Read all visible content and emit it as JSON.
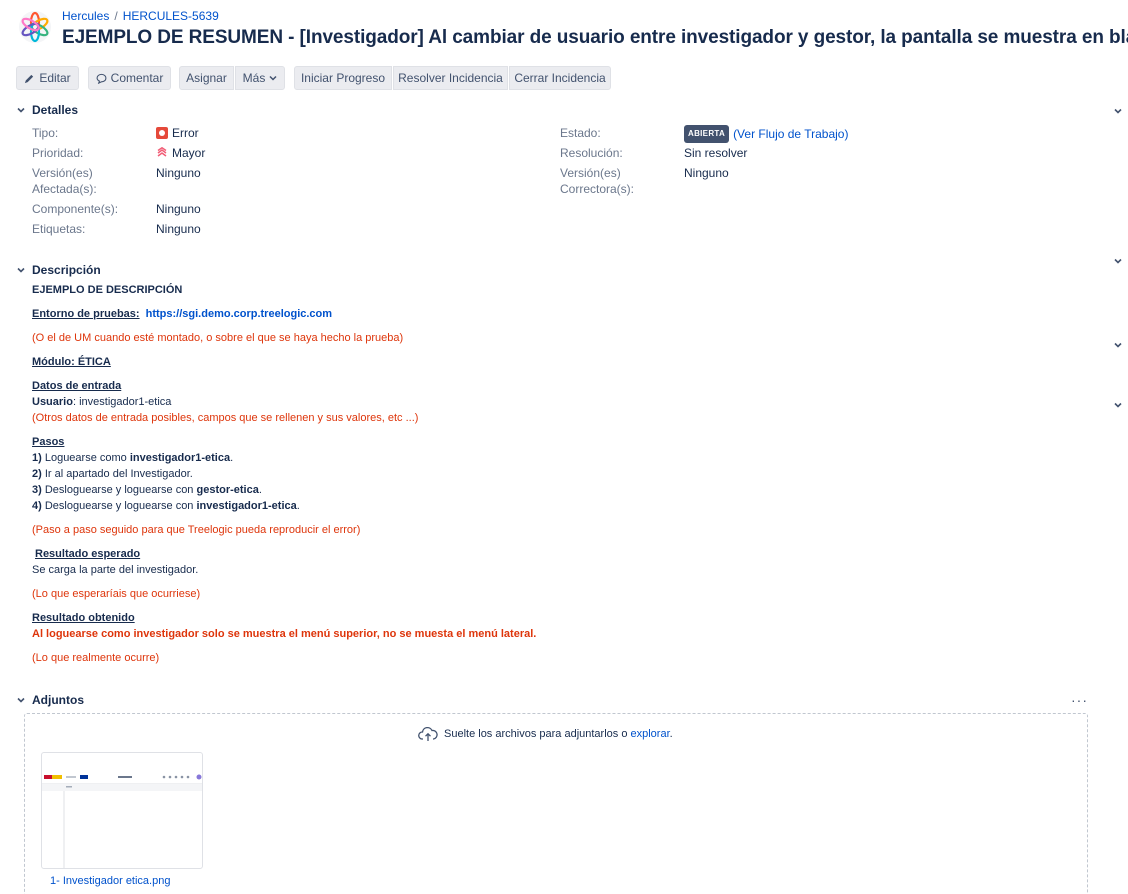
{
  "breadcrumb": {
    "project": "Hercules",
    "sep": "/",
    "issue_key": "HERCULES-5639"
  },
  "issue_title": "EJEMPLO DE RESUMEN - [Investigador] Al cambiar de usuario entre investigador y gestor, la pantalla se muestra en blanco",
  "toolbar": {
    "edit": "Editar",
    "comment": "Comentar",
    "assign": "Asignar",
    "more": "Más",
    "start_progress": "Iniciar Progreso",
    "resolve": "Resolver Incidencia",
    "close": "Cerrar Incidencia"
  },
  "details": {
    "heading": "Detalles",
    "type_label": "Tipo:",
    "type_value": "Error",
    "priority_label": "Prioridad:",
    "priority_value": "Mayor",
    "affects_label_1": "Versión(es)",
    "affects_label_2": "Afectada(s):",
    "affects_value": "Ninguno",
    "component_label": "Componente(s):",
    "component_value": "Ninguno",
    "labels_label": "Etiquetas:",
    "labels_value": "Ninguno",
    "status_label": "Estado:",
    "status_value": "ABIERTA",
    "workflow_link": "(Ver Flujo de Trabajo)",
    "resolution_label": "Resolución:",
    "resolution_value": "Sin resolver",
    "fix_label_1": "Versión(es)",
    "fix_label_2": "Correctora(s):",
    "fix_value": "Ninguno"
  },
  "description": {
    "heading": "Descripción",
    "title": "EJEMPLO DE DESCRIPCIÓN",
    "env_label": "Entorno de pruebas:",
    "env_url": "https://sgi.demo.corp.treelogic.com",
    "env_note": "(O el de UM cuando esté montado, o sobre el que se haya hecho la prueba)",
    "module": "Módulo: ÉTICA",
    "input_heading": "Datos de entrada",
    "user_label": "Usuario",
    "user_value": ": investigador1-etica",
    "input_note": "(Otros datos de entrada posibles, campos que se rellenen y sus valores, etc ...)",
    "steps_heading": "Pasos",
    "step1_num": "1)",
    "step1_text": " Loguearse como ",
    "step1_bold": "investigador1-etica",
    "step1_end": ".",
    "step2_num": "2)",
    "step2_text": " Ir al apartado del Investigador.",
    "step3_num": "3)",
    "step3_text": " Desloguearse y loguearse con ",
    "step3_bold": "gestor-etica",
    "step3_end": ".",
    "step4_num": "4)",
    "step4_text": " Desloguearse y loguearse con ",
    "step4_bold": "investigador1-etica",
    "step4_end": ".",
    "steps_note": "(Paso a paso seguido para que Treelogic pueda reproducir el error)",
    "expected_heading": "Resultado esperado",
    "expected_text": "Se carga la parte del investigador.",
    "expected_note": "(Lo que esperaríais que ocurriese)",
    "obtained_heading": "Resultado obtenido",
    "obtained_text": "Al loguearse como investigador solo se muestra el menú superior, no se muesta el menú lateral.",
    "obtained_note": "(Lo que realmente ocurre)"
  },
  "attachments": {
    "heading": "Adjuntos",
    "more": "···",
    "drop_text": "Suelte los archivos para adjuntarlos o ",
    "browse_link": "explorar",
    "drop_end": ".",
    "file_name": "1- Investigador etica.png"
  },
  "colors": {
    "accent": "#0052cc",
    "error": "#e5493a",
    "red_text": "#de350b",
    "priority": "#f15c75"
  }
}
